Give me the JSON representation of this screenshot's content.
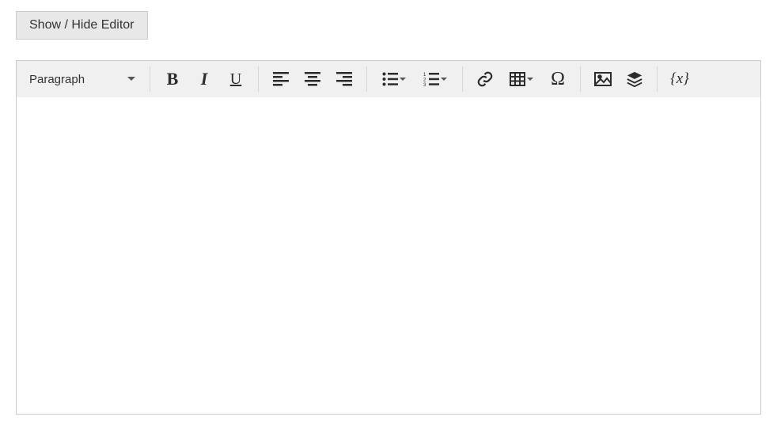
{
  "toggle": {
    "label": "Show / Hide Editor"
  },
  "toolbar": {
    "format_label": "Paragraph",
    "bold_glyph": "B",
    "italic_glyph": "I",
    "underline_glyph": "U",
    "omega_glyph": "Ω",
    "variable_glyph": "{x}"
  },
  "content": {
    "html": ""
  }
}
